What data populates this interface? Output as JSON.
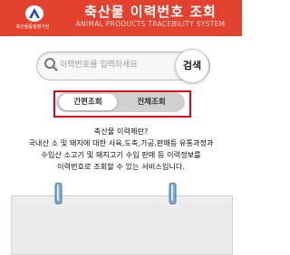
{
  "header": {
    "logo_text": "축산물품질평가원",
    "title": "축산물 이력번호 조회",
    "subtitle": "ANIMAL PRODUCTS TRACEBILITY SYSTEM"
  },
  "search": {
    "placeholder": "이력번호를 입력하세요",
    "value": "",
    "button_label": "검색"
  },
  "tabs": [
    {
      "label": "간편조회",
      "active": true
    },
    {
      "label": "전체조회",
      "active": false
    }
  ],
  "description": {
    "heading": "축산물 이력제란?",
    "lines": [
      "국내산 소 및 돼지에 대한 사육,도축,가공,판매등 유통과정과",
      "수입산 소고기 및 돼지고기 수입 판매 등 이력정보를",
      "이력번호로 조회할 수 있는 서비스입니다."
    ]
  },
  "colors": {
    "header_bg": "#e2412f",
    "highlight_border": "#e1001d",
    "tab_track": "#d0d0d0"
  }
}
